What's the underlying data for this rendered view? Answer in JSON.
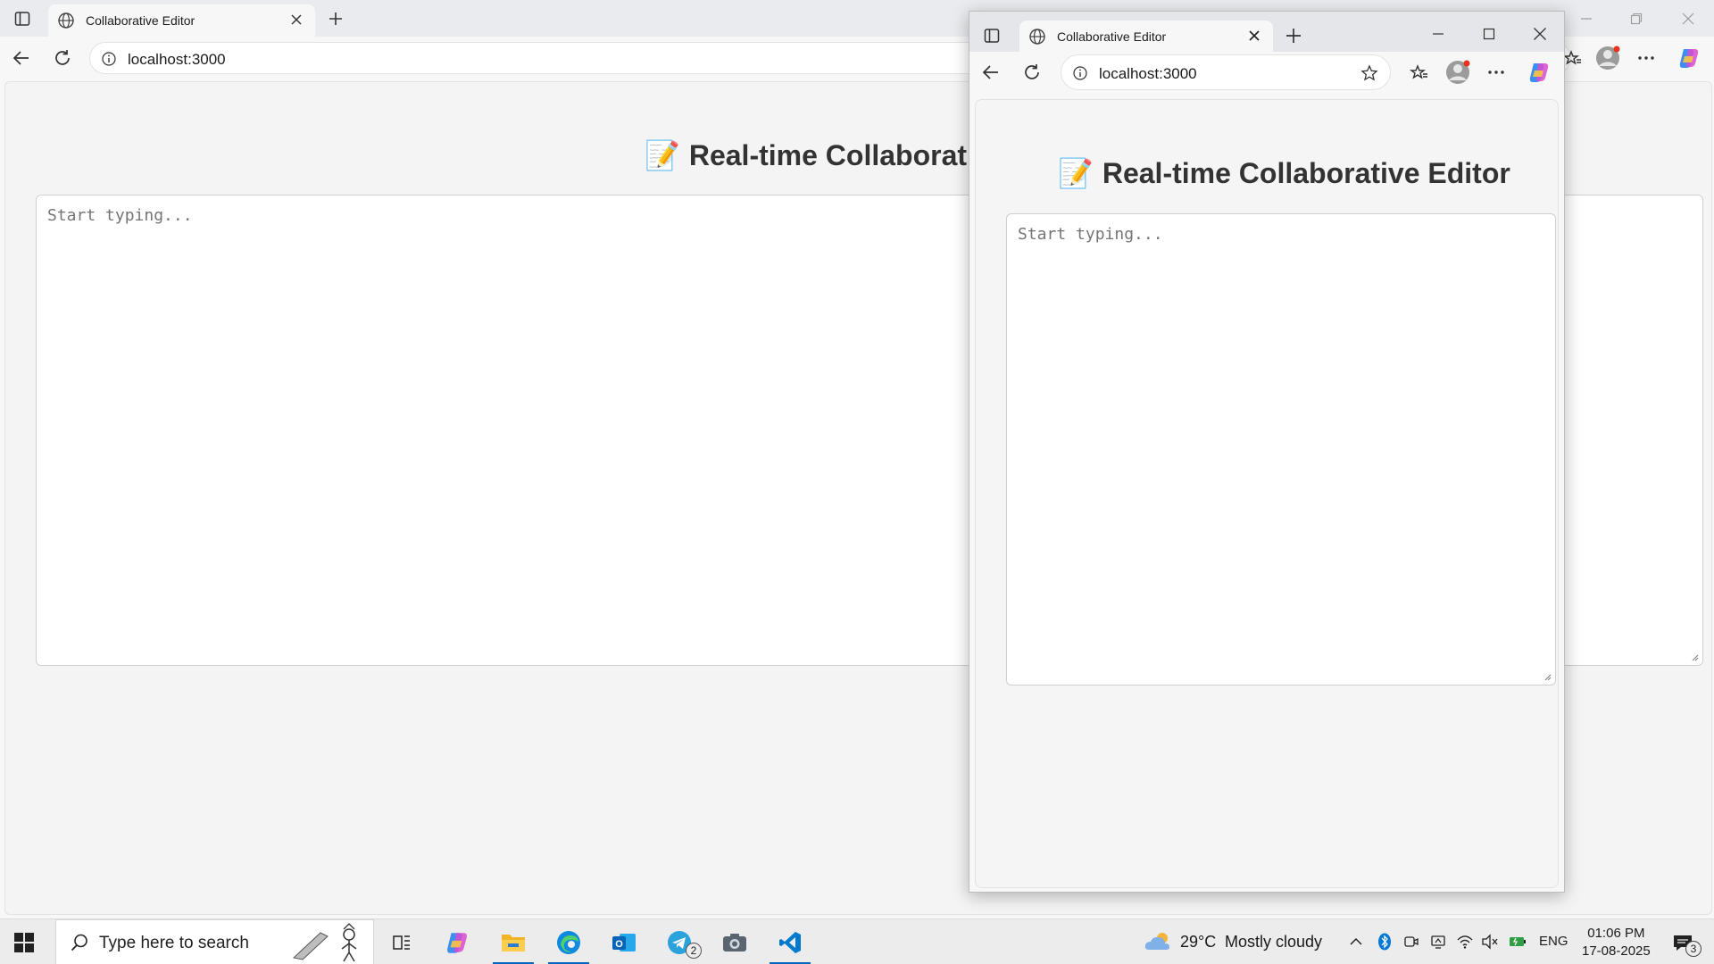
{
  "background_browser": {
    "tab_title": "Collaborative Editor",
    "url": "localhost:3000",
    "heading": "Real-time Collaborativ",
    "heading_emoji": "📝",
    "editor_placeholder": "Start typing..."
  },
  "foreground_window": {
    "tab_title": "Collaborative Editor",
    "url": "localhost:3000",
    "heading": "Real-time Collaborative Editor",
    "heading_emoji": "📝",
    "editor_placeholder": "Start typing..."
  },
  "taskbar": {
    "search_placeholder": "Type here to search",
    "telegram_badge": "2",
    "weather_temp": "29°C",
    "weather_desc": "Mostly cloudy",
    "language": "ENG",
    "time": "01:06 PM",
    "date": "17-08-2025",
    "notification_count": "3"
  },
  "colors": {
    "accent": "#0067c0",
    "edge_blue": "#0078d4",
    "vscode_blue": "#007acc",
    "folder_yellow": "#f0b429"
  }
}
